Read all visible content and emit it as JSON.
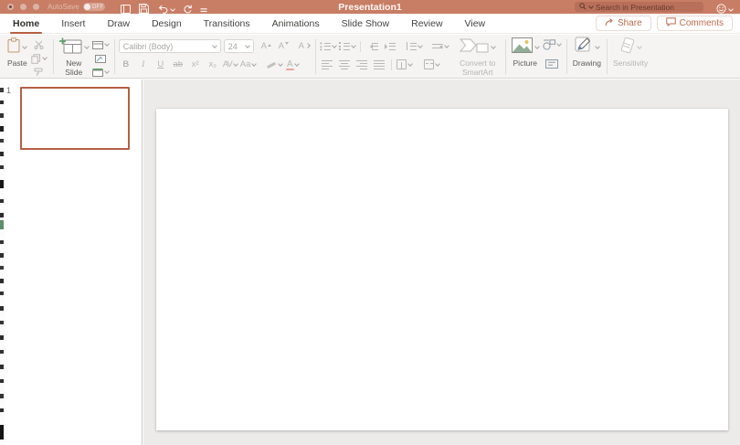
{
  "colors": {
    "titlebar_bg": "#c87d65",
    "accent": "#b5613f",
    "selected_slide_border": "#b55f45"
  },
  "titlebar": {
    "autosave_label": "AutoSave",
    "autosave_state": "Off",
    "title": "Presentation1",
    "search_placeholder": "Search in Presentation"
  },
  "tabs": {
    "items": [
      "Home",
      "Insert",
      "Draw",
      "Design",
      "Transitions",
      "Animations",
      "Slide Show",
      "Review",
      "View"
    ],
    "active": "Home"
  },
  "actions": {
    "share": "Share",
    "comments": "Comments"
  },
  "ribbon": {
    "paste": "Paste",
    "new_slide": "New Slide",
    "font_name": "Calibri (Body)",
    "font_size": "24",
    "bold": "B",
    "italic": "I",
    "underline": "U",
    "strikethrough": "ab",
    "superscript": "x²",
    "subscript": "x₂",
    "char_spacing": "AV",
    "change_case": "Aa",
    "font_color": "A",
    "grow_font": "A",
    "shrink_font": "A",
    "clear_format": "A",
    "convert_smartart": "Convert to\nSmartArt",
    "picture": "Picture",
    "drawing": "Drawing",
    "sensitivity": "Sensitivity"
  },
  "slide_panel": {
    "slide_number": "1"
  }
}
